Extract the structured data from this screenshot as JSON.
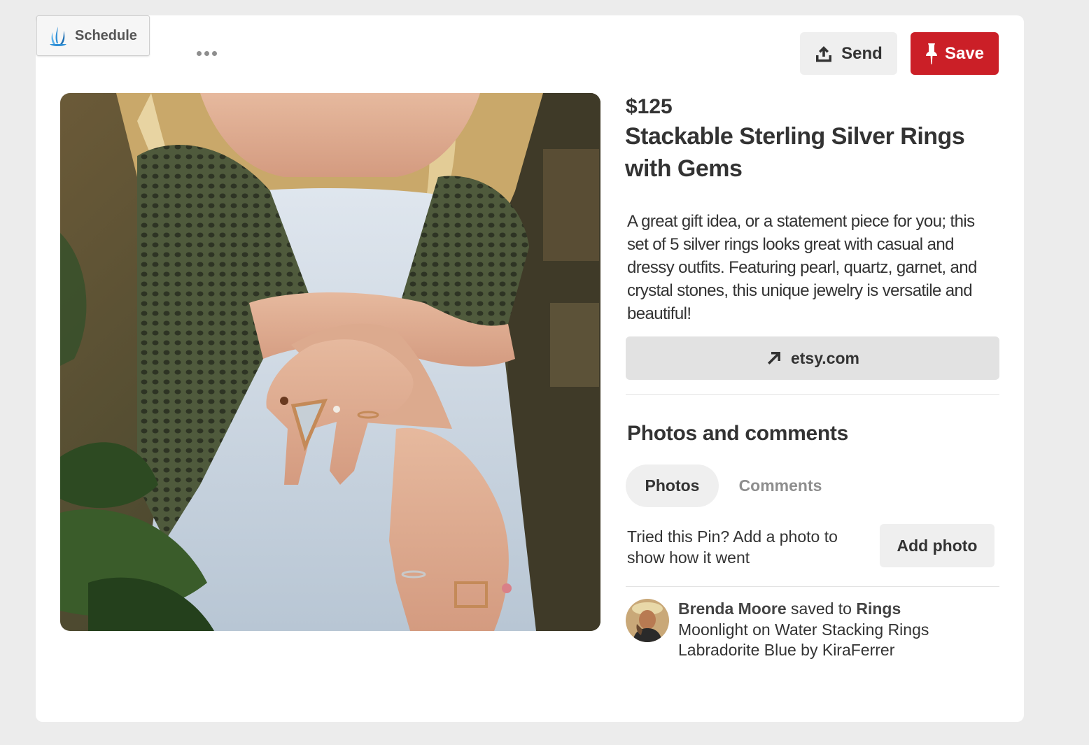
{
  "toolbar": {
    "schedule_label": "Schedule",
    "send_label": "Send",
    "save_label": "Save"
  },
  "pin": {
    "price": "$125",
    "title": "Stackable Sterling Silver Rings with Gems",
    "description": "A great gift idea, or a statement piece for you; this set of 5 silver rings looks great  with casual and dressy outfits. Featuring pearl, quartz, garnet, and crystal stones, this unique jewelry is versatile and beautiful!",
    "link_label": "etsy.com"
  },
  "photos_comments": {
    "heading": "Photos and comments",
    "tabs": [
      {
        "label": "Photos",
        "active": true
      },
      {
        "label": "Comments",
        "active": false
      }
    ],
    "prompt": "Tried this Pin? Add a photo to show how it went",
    "add_photo_label": "Add photo"
  },
  "activity": {
    "user": "Brenda Moore",
    "action": " saved to ",
    "board": "Rings",
    "item": "Moonlight on Water Stacking Rings Labradorite Blue by KiraFerrer"
  },
  "colors": {
    "save_red": "#cb1f27",
    "button_gray": "#efefef",
    "link_gray": "#e2e2e2",
    "text": "#333333"
  },
  "icons": [
    "schedule-logo-icon",
    "more-icon",
    "share-upload-icon",
    "pushpin-icon",
    "arrow-up-right-icon"
  ]
}
